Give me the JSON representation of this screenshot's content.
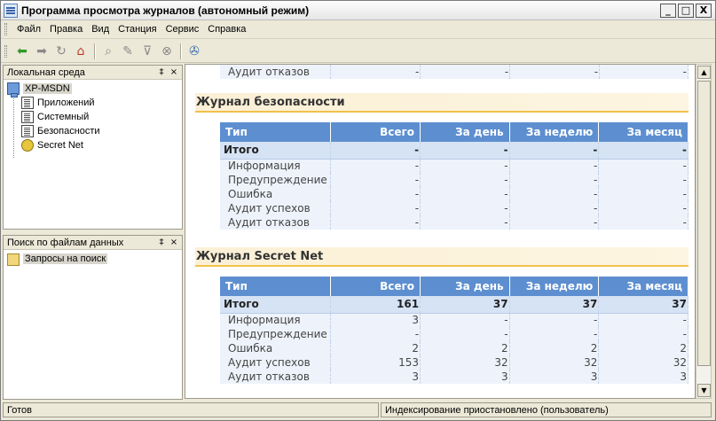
{
  "window": {
    "title": "Программа просмотра журналов (автономный режим)",
    "controls": [
      "_",
      "□",
      "X"
    ]
  },
  "menu": [
    "Файл",
    "Правка",
    "Вид",
    "Станция",
    "Сервис",
    "Справка"
  ],
  "menu_accels": [
    "Ф",
    "П",
    "В",
    "С",
    "е",
    "С"
  ],
  "toolbar": {
    "icons": [
      "back-arrow-icon",
      "forward-arrow-icon",
      "refresh-icon",
      "home-icon",
      "search-icon",
      "properties-icon",
      "filter-icon",
      "clear-filter-icon",
      "settings-wrench-icon"
    ]
  },
  "left_top": {
    "title": "Локальная среда",
    "pin": "‡",
    "close": "×",
    "root": "XP-MSDN",
    "items": [
      "Приложений",
      "Системный",
      "Безопасности",
      "Secret Net"
    ]
  },
  "left_bottom": {
    "title": "Поиск по файлам данных",
    "pin": "‡",
    "close": "×",
    "items": [
      "Запросы на поиск"
    ]
  },
  "columns": [
    "Тип",
    "Всего",
    "За день",
    "За неделю",
    "За месяц"
  ],
  "partial_row": {
    "label": "Аудит отказов",
    "values": [
      "-",
      "-",
      "-",
      "-"
    ]
  },
  "sections": [
    {
      "title": "Журнал безопасности",
      "total": {
        "label": "Итого",
        "values": [
          "-",
          "-",
          "-",
          "-"
        ]
      },
      "rows": [
        {
          "label": "Информация",
          "values": [
            "-",
            "-",
            "-",
            "-"
          ]
        },
        {
          "label": "Предупреждение",
          "values": [
            "-",
            "-",
            "-",
            "-"
          ]
        },
        {
          "label": "Ошибка",
          "values": [
            "-",
            "-",
            "-",
            "-"
          ]
        },
        {
          "label": "Аудит успехов",
          "values": [
            "-",
            "-",
            "-",
            "-"
          ]
        },
        {
          "label": "Аудит отказов",
          "values": [
            "-",
            "-",
            "-",
            "-"
          ]
        }
      ]
    },
    {
      "title": "Журнал Secret Net",
      "total": {
        "label": "Итого",
        "values": [
          "161",
          "37",
          "37",
          "37"
        ]
      },
      "rows": [
        {
          "label": "Информация",
          "values": [
            "3",
            "-",
            "-",
            "-"
          ]
        },
        {
          "label": "Предупреждение",
          "values": [
            "-",
            "-",
            "-",
            "-"
          ]
        },
        {
          "label": "Ошибка",
          "values": [
            "2",
            "2",
            "2",
            "2"
          ]
        },
        {
          "label": "Аудит успехов",
          "values": [
            "153",
            "32",
            "32",
            "32"
          ]
        },
        {
          "label": "Аудит отказов",
          "values": [
            "3",
            "3",
            "3",
            "3"
          ]
        }
      ]
    }
  ],
  "scrollbar": {
    "up": "▲",
    "down": "▼"
  },
  "status": {
    "left": "Готов",
    "right": "Индексирование приостановлено (пользователь)"
  }
}
